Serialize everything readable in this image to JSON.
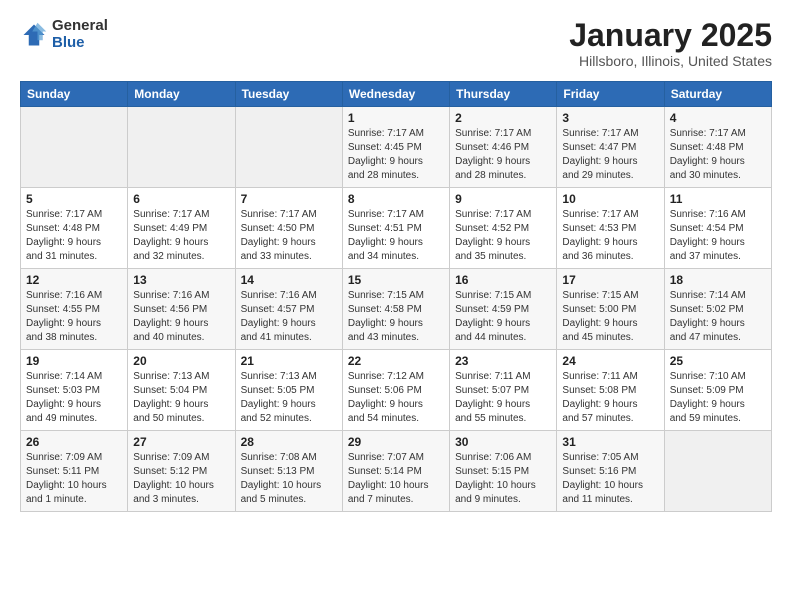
{
  "logo": {
    "general": "General",
    "blue": "Blue"
  },
  "title": "January 2025",
  "subtitle": "Hillsboro, Illinois, United States",
  "days_header": [
    "Sunday",
    "Monday",
    "Tuesday",
    "Wednesday",
    "Thursday",
    "Friday",
    "Saturday"
  ],
  "weeks": [
    [
      {
        "day": "",
        "info": ""
      },
      {
        "day": "",
        "info": ""
      },
      {
        "day": "",
        "info": ""
      },
      {
        "day": "1",
        "info": "Sunrise: 7:17 AM\nSunset: 4:45 PM\nDaylight: 9 hours\nand 28 minutes."
      },
      {
        "day": "2",
        "info": "Sunrise: 7:17 AM\nSunset: 4:46 PM\nDaylight: 9 hours\nand 28 minutes."
      },
      {
        "day": "3",
        "info": "Sunrise: 7:17 AM\nSunset: 4:47 PM\nDaylight: 9 hours\nand 29 minutes."
      },
      {
        "day": "4",
        "info": "Sunrise: 7:17 AM\nSunset: 4:48 PM\nDaylight: 9 hours\nand 30 minutes."
      }
    ],
    [
      {
        "day": "5",
        "info": "Sunrise: 7:17 AM\nSunset: 4:48 PM\nDaylight: 9 hours\nand 31 minutes."
      },
      {
        "day": "6",
        "info": "Sunrise: 7:17 AM\nSunset: 4:49 PM\nDaylight: 9 hours\nand 32 minutes."
      },
      {
        "day": "7",
        "info": "Sunrise: 7:17 AM\nSunset: 4:50 PM\nDaylight: 9 hours\nand 33 minutes."
      },
      {
        "day": "8",
        "info": "Sunrise: 7:17 AM\nSunset: 4:51 PM\nDaylight: 9 hours\nand 34 minutes."
      },
      {
        "day": "9",
        "info": "Sunrise: 7:17 AM\nSunset: 4:52 PM\nDaylight: 9 hours\nand 35 minutes."
      },
      {
        "day": "10",
        "info": "Sunrise: 7:17 AM\nSunset: 4:53 PM\nDaylight: 9 hours\nand 36 minutes."
      },
      {
        "day": "11",
        "info": "Sunrise: 7:16 AM\nSunset: 4:54 PM\nDaylight: 9 hours\nand 37 minutes."
      }
    ],
    [
      {
        "day": "12",
        "info": "Sunrise: 7:16 AM\nSunset: 4:55 PM\nDaylight: 9 hours\nand 38 minutes."
      },
      {
        "day": "13",
        "info": "Sunrise: 7:16 AM\nSunset: 4:56 PM\nDaylight: 9 hours\nand 40 minutes."
      },
      {
        "day": "14",
        "info": "Sunrise: 7:16 AM\nSunset: 4:57 PM\nDaylight: 9 hours\nand 41 minutes."
      },
      {
        "day": "15",
        "info": "Sunrise: 7:15 AM\nSunset: 4:58 PM\nDaylight: 9 hours\nand 43 minutes."
      },
      {
        "day": "16",
        "info": "Sunrise: 7:15 AM\nSunset: 4:59 PM\nDaylight: 9 hours\nand 44 minutes."
      },
      {
        "day": "17",
        "info": "Sunrise: 7:15 AM\nSunset: 5:00 PM\nDaylight: 9 hours\nand 45 minutes."
      },
      {
        "day": "18",
        "info": "Sunrise: 7:14 AM\nSunset: 5:02 PM\nDaylight: 9 hours\nand 47 minutes."
      }
    ],
    [
      {
        "day": "19",
        "info": "Sunrise: 7:14 AM\nSunset: 5:03 PM\nDaylight: 9 hours\nand 49 minutes."
      },
      {
        "day": "20",
        "info": "Sunrise: 7:13 AM\nSunset: 5:04 PM\nDaylight: 9 hours\nand 50 minutes."
      },
      {
        "day": "21",
        "info": "Sunrise: 7:13 AM\nSunset: 5:05 PM\nDaylight: 9 hours\nand 52 minutes."
      },
      {
        "day": "22",
        "info": "Sunrise: 7:12 AM\nSunset: 5:06 PM\nDaylight: 9 hours\nand 54 minutes."
      },
      {
        "day": "23",
        "info": "Sunrise: 7:11 AM\nSunset: 5:07 PM\nDaylight: 9 hours\nand 55 minutes."
      },
      {
        "day": "24",
        "info": "Sunrise: 7:11 AM\nSunset: 5:08 PM\nDaylight: 9 hours\nand 57 minutes."
      },
      {
        "day": "25",
        "info": "Sunrise: 7:10 AM\nSunset: 5:09 PM\nDaylight: 9 hours\nand 59 minutes."
      }
    ],
    [
      {
        "day": "26",
        "info": "Sunrise: 7:09 AM\nSunset: 5:11 PM\nDaylight: 10 hours\nand 1 minute."
      },
      {
        "day": "27",
        "info": "Sunrise: 7:09 AM\nSunset: 5:12 PM\nDaylight: 10 hours\nand 3 minutes."
      },
      {
        "day": "28",
        "info": "Sunrise: 7:08 AM\nSunset: 5:13 PM\nDaylight: 10 hours\nand 5 minutes."
      },
      {
        "day": "29",
        "info": "Sunrise: 7:07 AM\nSunset: 5:14 PM\nDaylight: 10 hours\nand 7 minutes."
      },
      {
        "day": "30",
        "info": "Sunrise: 7:06 AM\nSunset: 5:15 PM\nDaylight: 10 hours\nand 9 minutes."
      },
      {
        "day": "31",
        "info": "Sunrise: 7:05 AM\nSunset: 5:16 PM\nDaylight: 10 hours\nand 11 minutes."
      },
      {
        "day": "",
        "info": ""
      }
    ]
  ]
}
